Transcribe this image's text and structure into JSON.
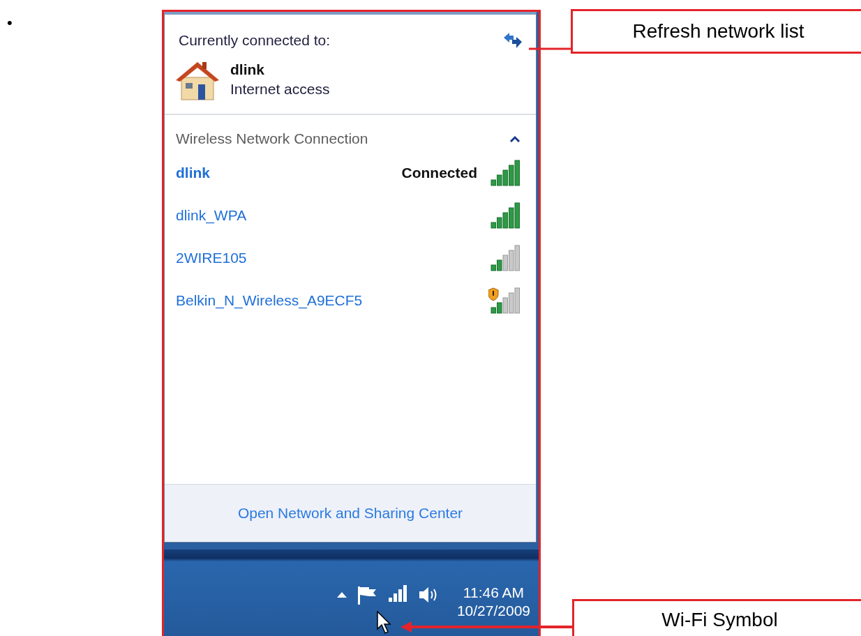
{
  "bullet": "•",
  "panel": {
    "header": "Currently connected to:",
    "current": {
      "name": "dlink",
      "status": "Internet access"
    },
    "section": {
      "title": "Wireless Network Connection",
      "expanded": true
    },
    "networks": [
      {
        "name": "dlink",
        "selected": true,
        "status": "Connected",
        "kind": "strong",
        "warning": false
      },
      {
        "name": "dlink_WPA",
        "selected": false,
        "kind": "strong",
        "warning": false
      },
      {
        "name": "2WIRE105",
        "selected": false,
        "kind": "weak",
        "warning": false
      },
      {
        "name": "Belkin_N_Wireless_A9ECF5",
        "selected": false,
        "kind": "weak",
        "warning": true
      }
    ],
    "footer_link": "Open Network and Sharing Center"
  },
  "taskbar": {
    "time": "11:46 AM",
    "date": "10/27/2009"
  },
  "callouts": [
    {
      "label": "Refresh network list"
    },
    {
      "label": "Wi-Fi Symbol"
    }
  ]
}
